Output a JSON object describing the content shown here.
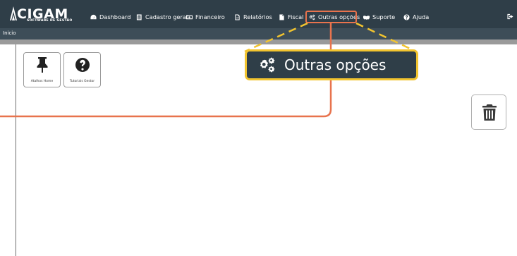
{
  "brand": {
    "name": "CIGAM",
    "tagline": "SOFTWARE DE GESTÃO"
  },
  "nav": {
    "items": [
      {
        "label": "Dashboard",
        "icon": "dashboard-icon"
      },
      {
        "label": "Cadastro geral",
        "icon": "address-book-icon"
      },
      {
        "label": "Financeiro",
        "icon": "money-icon"
      },
      {
        "label": "Relatórios",
        "icon": "report-icon"
      },
      {
        "label": "Fiscal",
        "icon": "document-icon"
      },
      {
        "label": "Outras opções",
        "icon": "gears-icon"
      },
      {
        "label": "Suporte",
        "icon": "handshake-icon"
      },
      {
        "label": "Ajuda",
        "icon": "help-icon"
      }
    ],
    "exit_icon": "sign-out-icon"
  },
  "breadcrumb": "Inicio",
  "tiles": [
    {
      "label": "Atalhos Home",
      "icon": "thumbtack-icon"
    },
    {
      "label": "Tutoriais Gestor",
      "icon": "question-circle-icon"
    }
  ],
  "trash": {
    "icon": "trash-icon"
  },
  "callout": {
    "label": "Outras opções",
    "icon": "gears-icon"
  },
  "colors": {
    "navbar": "#2f3e48",
    "highlight_border": "#e8734d",
    "callout_border": "#f2c42f"
  }
}
